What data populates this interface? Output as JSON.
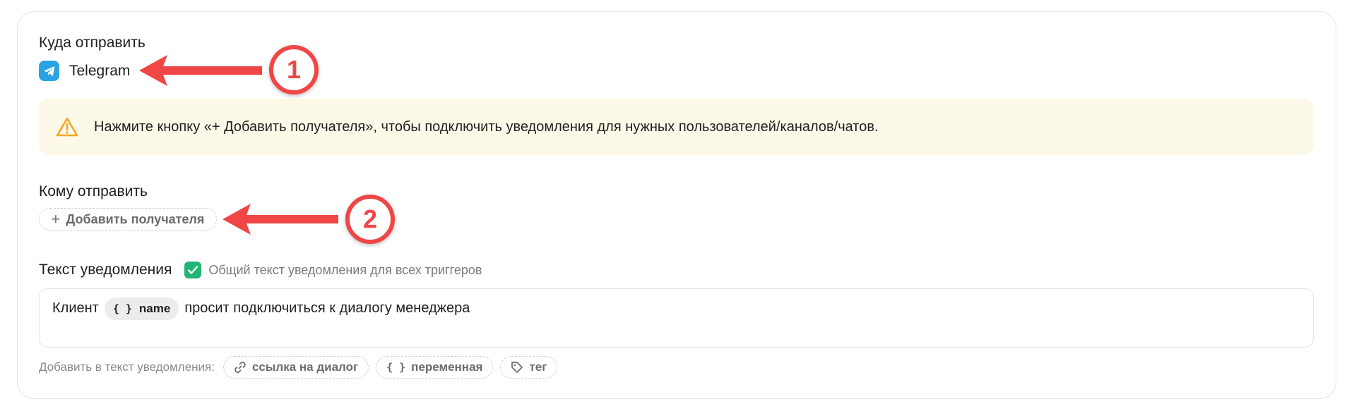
{
  "destination": {
    "label": "Куда отправить",
    "channel": "Telegram"
  },
  "notice": {
    "text": "Нажмите кнопку «+ Добавить получателя», чтобы подключить уведомления для нужных пользователей/каналов/чатов."
  },
  "recipients": {
    "label": "Кому отправить",
    "add_button": "Добавить получателя"
  },
  "notification_text": {
    "label": "Текст уведомления",
    "common_checkbox_label": "Общий текст уведомления для всех триггеров",
    "common_checked": true,
    "content_before": "Клиент",
    "variable": "name",
    "content_after": "просит подключиться к диалогу менеджера"
  },
  "insert": {
    "label": "Добавить в текст уведомления:",
    "options": [
      {
        "label": "ссылка на диалог",
        "icon": "link-icon"
      },
      {
        "label": "переменная",
        "icon": "braces-icon"
      },
      {
        "label": "тег",
        "icon": "tag-icon"
      }
    ]
  },
  "annotations": {
    "badge_1": "1",
    "badge_2": "2"
  },
  "colors": {
    "telegram": "#2aa3e2",
    "notice_bg": "#fdf9e9",
    "warning": "#f5a623",
    "checkbox": "#22b573",
    "annotation": "#f04646"
  }
}
